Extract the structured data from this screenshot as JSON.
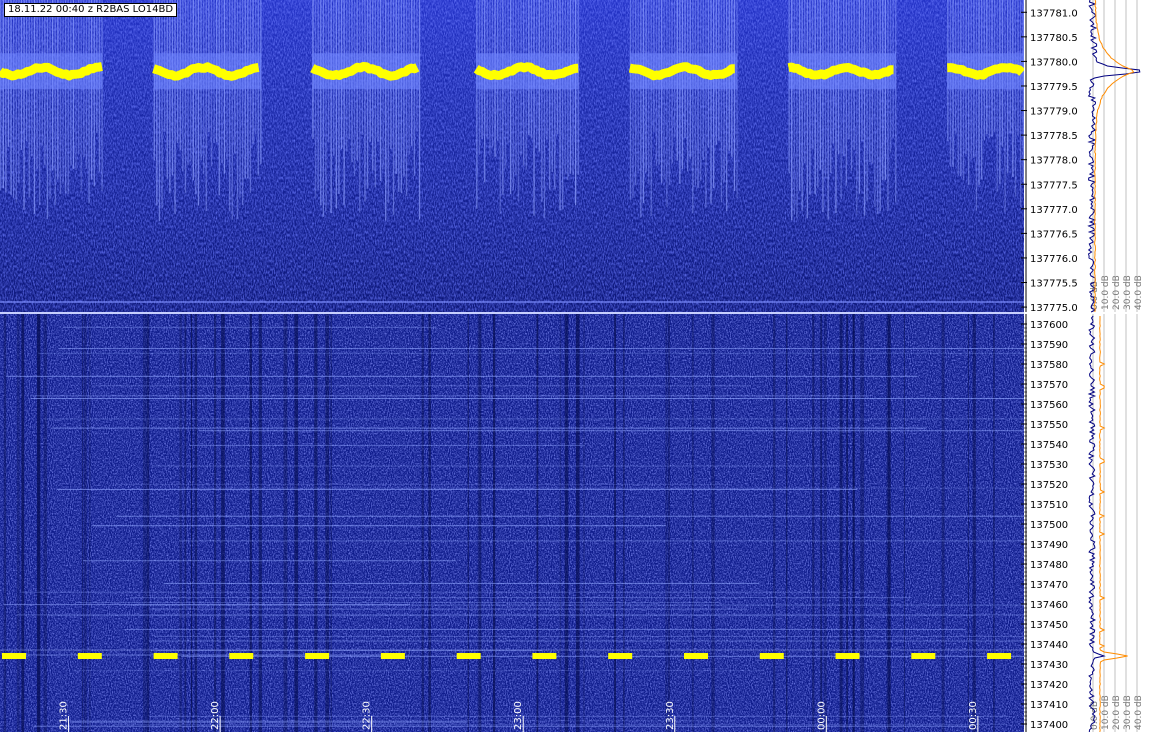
{
  "header": {
    "title": "18.11.22  00:40 z  R2BAS  LO14BD"
  },
  "top_waterfall": {
    "freq_ticks": [
      "137781.0",
      "137780.5",
      "137780.0",
      "137779.5",
      "137779.0",
      "137778.5",
      "137778.0",
      "137777.5",
      "137777.0",
      "137776.5",
      "137776.0",
      "137775.5",
      "137775.0"
    ],
    "freq_values": [
      137781.0,
      137780.5,
      137780.0,
      137779.5,
      137779.0,
      137778.5,
      137778.0,
      137777.5,
      137777.0,
      137776.5,
      137776.0,
      137775.5,
      137775.0
    ],
    "freq_range": [
      137774.9,
      137781.25
    ],
    "signal_freq": 137779.8,
    "on_intervals_fraction": [
      [
        0.0,
        0.1
      ],
      [
        0.15,
        0.255
      ],
      [
        0.305,
        0.41
      ],
      [
        0.465,
        0.565
      ],
      [
        0.615,
        0.72
      ],
      [
        0.77,
        0.875
      ],
      [
        0.925,
        1.0
      ]
    ],
    "spectrum_db_labels": [
      "0.0 dB",
      "10.0 dB",
      "20.0 dB",
      "30.0 dB",
      "40.0 dB"
    ]
  },
  "bottom_waterfall": {
    "freq_ticks": [
      "137600",
      "137590",
      "137580",
      "137570",
      "137560",
      "137550",
      "137540",
      "137530",
      "137520",
      "137510",
      "137500",
      "137490",
      "137480",
      "137470",
      "137460",
      "137450",
      "137440",
      "137430",
      "137420",
      "137410",
      "137400"
    ],
    "freq_values": [
      137600,
      137590,
      137580,
      137570,
      137560,
      137550,
      137540,
      137530,
      137520,
      137510,
      137500,
      137490,
      137480,
      137470,
      137460,
      137450,
      137440,
      137430,
      137420,
      137410,
      137400
    ],
    "freq_range": [
      137396,
      137605
    ],
    "beacon_freq": 137434,
    "beacon_start_times_fraction": [
      0.0,
      0.074,
      0.148,
      0.222,
      0.296,
      0.37,
      0.444,
      0.518,
      0.592,
      0.666,
      0.74,
      0.814,
      0.888,
      0.962
    ],
    "time_labels": [
      "21:30",
      "22:00",
      "22:30",
      "23:00",
      "23:30",
      "00:00",
      "00:30"
    ],
    "time_positions_fraction": [
      0.065,
      0.213,
      0.361,
      0.509,
      0.657,
      0.805,
      0.953
    ],
    "spectrum_db_labels": [
      "0.0 dB",
      "10.0 dB",
      "20.0 dB",
      "30.0 dB",
      "40.0 dB"
    ]
  },
  "colors": {
    "waterfall_bg": "#0a1566",
    "signal": "#ffff00",
    "noise_line": "#000080",
    "average_line": "#ff8c00",
    "tick_text": "#000000"
  }
}
